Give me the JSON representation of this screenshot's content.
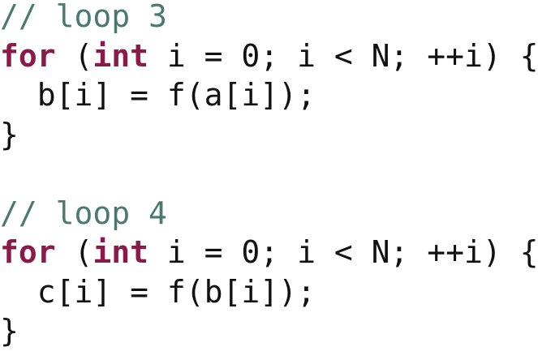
{
  "code_snippet": {
    "block1": {
      "comment": "// loop 3",
      "kw_for": "for",
      "paren_open": " (",
      "kw_int": "int",
      "header_rest": " i = 0; i < N; ++i) {",
      "body": "  b[i] = f(a[i]);",
      "close": "}"
    },
    "block2": {
      "comment": "// loop 4",
      "kw_for": "for",
      "paren_open": " (",
      "kw_int": "int",
      "header_rest": " i = 0; i < N; ++i) {",
      "body": "  c[i] = f(b[i]);",
      "close": "}"
    },
    "colors": {
      "comment": "#4a7a6e",
      "keyword": "#8b1a4a",
      "text": "#111111",
      "background": "#ffffff"
    }
  }
}
